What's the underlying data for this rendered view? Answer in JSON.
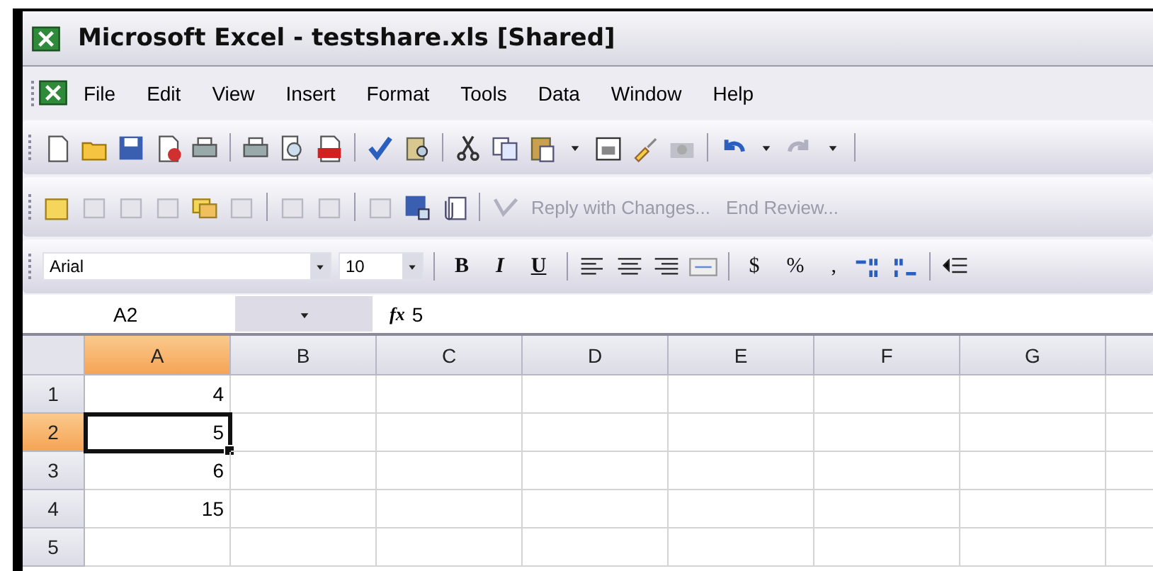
{
  "window": {
    "title": "Microsoft Excel - testshare.xls  [Shared]"
  },
  "menu": [
    {
      "label": "File"
    },
    {
      "label": "Edit"
    },
    {
      "label": "View"
    },
    {
      "label": "Insert"
    },
    {
      "label": "Format"
    },
    {
      "label": "Tools"
    },
    {
      "label": "Data"
    },
    {
      "label": "Window"
    },
    {
      "label": "Help"
    }
  ],
  "reviewing_toolbar": {
    "actions": [
      {
        "label": "Reply with Changes...",
        "disabled": true
      },
      {
        "label": "End Review...",
        "disabled": true
      }
    ]
  },
  "formatting_toolbar": {
    "font": "Arial",
    "size": "10",
    "buttons": [
      {
        "label": "B",
        "kind": "bold"
      },
      {
        "label": "I",
        "kind": "italic"
      },
      {
        "label": "U",
        "kind": "underline"
      },
      {
        "label": "$",
        "kind": "plain"
      },
      {
        "label": "%",
        "kind": "plain"
      },
      {
        "label": ",",
        "kind": "plain"
      }
    ]
  },
  "formula_bar": {
    "name_box": "A2",
    "fx": "fx",
    "formula": "5"
  },
  "sheet": {
    "columns": [
      {
        "label": "A",
        "selected": true
      },
      {
        "label": "B",
        "selected": false
      },
      {
        "label": "C",
        "selected": false
      },
      {
        "label": "D",
        "selected": false
      },
      {
        "label": "E",
        "selected": false
      },
      {
        "label": "F",
        "selected": false
      },
      {
        "label": "G",
        "selected": false
      }
    ],
    "rows": [
      {
        "label": "1",
        "selected": false,
        "cells": [
          "4"
        ]
      },
      {
        "label": "2",
        "selected": true,
        "cells": [
          "5"
        ]
      },
      {
        "label": "3",
        "selected": false,
        "cells": [
          "6"
        ]
      },
      {
        "label": "4",
        "selected": false,
        "cells": [
          "15"
        ]
      },
      {
        "label": "5",
        "selected": false,
        "cells": []
      }
    ]
  }
}
